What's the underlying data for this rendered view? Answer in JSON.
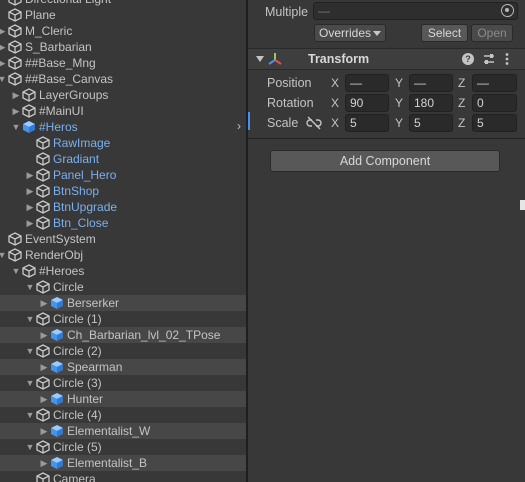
{
  "hierarchy": {
    "items": [
      {
        "label": "Directional Light",
        "depth": 1,
        "arrow": "none",
        "icon": "gameobject",
        "prefab": false,
        "alt": false
      },
      {
        "label": "Plane",
        "depth": 1,
        "arrow": "none",
        "icon": "gameobject",
        "prefab": false,
        "alt": false
      },
      {
        "label": "M_Cleric",
        "depth": 1,
        "arrow": "collapsed",
        "icon": "gameobject",
        "prefab": false,
        "alt": false
      },
      {
        "label": "S_Barbarian",
        "depth": 1,
        "arrow": "collapsed",
        "icon": "gameobject",
        "prefab": false,
        "alt": false
      },
      {
        "label": "##Base_Mng",
        "depth": 1,
        "arrow": "collapsed",
        "icon": "gameobject",
        "prefab": false,
        "alt": false
      },
      {
        "label": "##Base_Canvas",
        "depth": 1,
        "arrow": "expanded",
        "icon": "gameobject",
        "prefab": false,
        "alt": false
      },
      {
        "label": "LayerGroups",
        "depth": 2,
        "arrow": "collapsed",
        "icon": "gameobject",
        "prefab": false,
        "alt": false
      },
      {
        "label": "#MainUI",
        "depth": 2,
        "arrow": "collapsed",
        "icon": "gameobject",
        "prefab": false,
        "alt": false
      },
      {
        "label": "#Heros",
        "depth": 2,
        "arrow": "expanded",
        "icon": "prefab",
        "prefab": true,
        "alt": false
      },
      {
        "label": "RawImage",
        "depth": 3,
        "arrow": "none",
        "icon": "gameobject",
        "prefab": true,
        "alt": false
      },
      {
        "label": "Gradiant",
        "depth": 3,
        "arrow": "none",
        "icon": "gameobject",
        "prefab": true,
        "alt": false
      },
      {
        "label": "Panel_Hero",
        "depth": 3,
        "arrow": "collapsed",
        "icon": "gameobject",
        "prefab": true,
        "alt": false
      },
      {
        "label": "BtnShop",
        "depth": 3,
        "arrow": "collapsed",
        "icon": "gameobject",
        "prefab": true,
        "alt": false
      },
      {
        "label": "BtnUpgrade",
        "depth": 3,
        "arrow": "collapsed",
        "icon": "gameobject",
        "prefab": true,
        "alt": false
      },
      {
        "label": "Btn_Close",
        "depth": 3,
        "arrow": "collapsed",
        "icon": "gameobject",
        "prefab": true,
        "alt": false
      },
      {
        "label": "EventSystem",
        "depth": 1,
        "arrow": "none",
        "icon": "gameobject",
        "prefab": false,
        "alt": false
      },
      {
        "label": "RenderObj",
        "depth": 1,
        "arrow": "expanded",
        "icon": "gameobject",
        "prefab": false,
        "alt": false
      },
      {
        "label": "#Heroes",
        "depth": 2,
        "arrow": "expanded",
        "icon": "gameobject",
        "prefab": false,
        "alt": false
      },
      {
        "label": "Circle",
        "depth": 3,
        "arrow": "expanded",
        "icon": "gameobject",
        "prefab": false,
        "alt": false
      },
      {
        "label": "Berserker",
        "depth": 4,
        "arrow": "collapsed",
        "icon": "prefab",
        "prefab": false,
        "alt": true
      },
      {
        "label": "Circle (1)",
        "depth": 3,
        "arrow": "expanded",
        "icon": "gameobject",
        "prefab": false,
        "alt": false
      },
      {
        "label": "Ch_Barbarian_lvl_02_TPose",
        "depth": 4,
        "arrow": "collapsed",
        "icon": "prefab",
        "prefab": false,
        "alt": true
      },
      {
        "label": "Circle (2)",
        "depth": 3,
        "arrow": "expanded",
        "icon": "gameobject",
        "prefab": false,
        "alt": false
      },
      {
        "label": "Spearman",
        "depth": 4,
        "arrow": "collapsed",
        "icon": "prefab",
        "prefab": false,
        "alt": true
      },
      {
        "label": "Circle (3)",
        "depth": 3,
        "arrow": "expanded",
        "icon": "gameobject",
        "prefab": false,
        "alt": false
      },
      {
        "label": "Hunter",
        "depth": 4,
        "arrow": "collapsed",
        "icon": "prefab",
        "prefab": false,
        "alt": true
      },
      {
        "label": "Circle (4)",
        "depth": 3,
        "arrow": "expanded",
        "icon": "gameobject",
        "prefab": false,
        "alt": false
      },
      {
        "label": "Elementalist_W",
        "depth": 4,
        "arrow": "collapsed",
        "icon": "prefab",
        "prefab": false,
        "alt": true
      },
      {
        "label": "Circle (5)",
        "depth": 3,
        "arrow": "expanded",
        "icon": "gameobject",
        "prefab": false,
        "alt": false
      },
      {
        "label": "Elementalist_B",
        "depth": 4,
        "arrow": "collapsed",
        "icon": "prefab",
        "prefab": false,
        "alt": true
      },
      {
        "label": "Camera",
        "depth": 3,
        "arrow": "none",
        "icon": "gameobject",
        "prefab": false,
        "alt": false
      }
    ]
  },
  "inspector": {
    "multiple_label": "Multiple",
    "name_field_value": "—",
    "overrides_label": "Overrides",
    "select_label": "Select",
    "open_label": "Open",
    "transform": {
      "title": "Transform",
      "rows": [
        {
          "label": "Position",
          "x": "—",
          "y": "—",
          "z": "—"
        },
        {
          "label": "Rotation",
          "x": "90",
          "y": "180",
          "z": "0"
        },
        {
          "label": "Scale",
          "x": "5",
          "y": "5",
          "z": "5"
        }
      ],
      "axis_x": "X",
      "axis_y": "Y",
      "axis_z": "Z"
    },
    "add_component_label": "Add Component"
  },
  "colors": {
    "panel_bg": "#383838",
    "row_alt_bg": "#474747",
    "prefab_text": "#7ab0f0",
    "prefab_icon": "#6aa8e8",
    "text": "#c4c4c4",
    "field_bg": "#2a2a2a",
    "button_bg": "#585858"
  }
}
